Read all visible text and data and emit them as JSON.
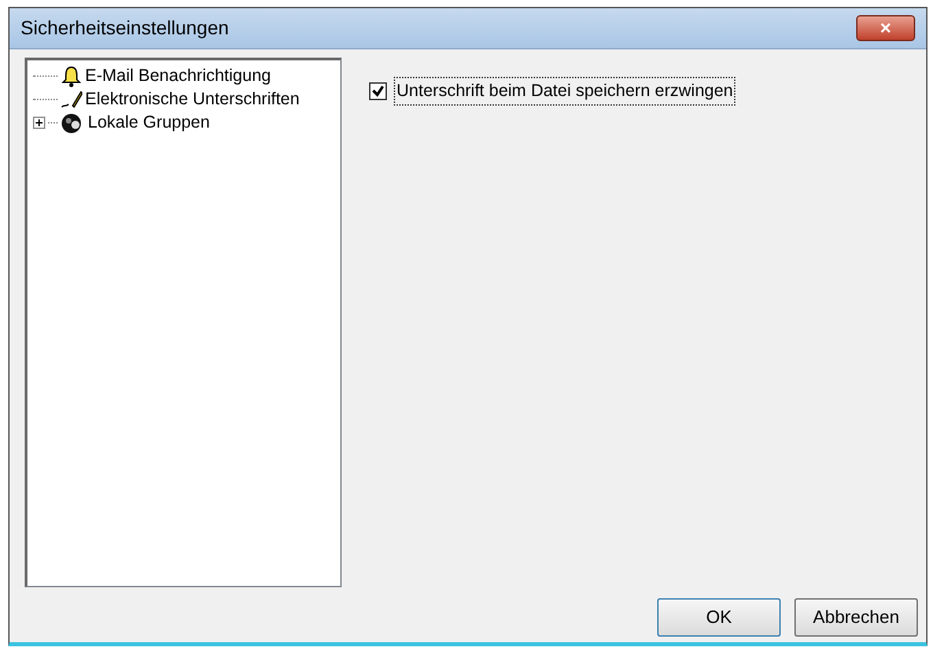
{
  "window": {
    "title": "Sicherheitseinstellungen",
    "close": "×"
  },
  "tree": [
    {
      "label": "E-Mail Benachrichtigung",
      "kind": "leaf"
    },
    {
      "label": "Elektronische Unterschriften",
      "kind": "leaf"
    },
    {
      "label": "Lokale Gruppen",
      "kind": "folder",
      "expanded": false
    }
  ],
  "options": [
    {
      "label": "Unterschrift beim Datei speichern erzwingen",
      "checked": true,
      "focused": true
    }
  ],
  "buttons": [
    {
      "label": "OK",
      "default": true
    },
    {
      "label": "Abbrechen",
      "default": false
    }
  ]
}
